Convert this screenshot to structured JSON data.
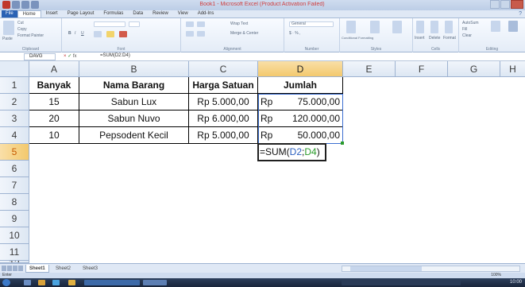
{
  "window": {
    "title": "Book1 - Microsoft Excel (Product Activation Failed)"
  },
  "ribbon": {
    "file_tab": "File",
    "tabs": [
      "Home",
      "Insert",
      "Page Layout",
      "Formulas",
      "Data",
      "Review",
      "View",
      "Add-Ins"
    ],
    "active_tab": "Home",
    "groups": [
      "Clipboard",
      "Font",
      "Alignment",
      "Number",
      "Styles",
      "Cells",
      "Editing"
    ],
    "buttons": {
      "paste": "Paste",
      "cut": "Cut",
      "copy": "Copy",
      "format_painter": "Format Painter",
      "wrap_text": "Wrap Text",
      "merge_center": "Merge & Center",
      "number_format": "General",
      "conditional_formatting": "Conditional Formatting",
      "format_as_table": "Format as Table",
      "cell_styles": "Cell Styles",
      "insert": "Insert",
      "delete": "Delete",
      "format": "Format",
      "autosum": "AutoSum",
      "fill": "Fill",
      "clear": "Clear",
      "sort_filter": "Sort & Filter",
      "find_select": "Find & Select"
    }
  },
  "formula_bar": {
    "name_box": "DAVG",
    "cancel": "×",
    "enter": "✓",
    "fx": "fx",
    "formula": "=SUM(D2:D4)"
  },
  "columns": [
    "A",
    "B",
    "C",
    "D",
    "E",
    "F",
    "G",
    "H"
  ],
  "rows": [
    "1",
    "2",
    "3",
    "4",
    "5",
    "6",
    "7",
    "8",
    "9",
    "10",
    "11",
    "12"
  ],
  "table": {
    "headers": [
      "Banyak",
      "Nama Barang",
      "Harga Satuan",
      "Jumlah"
    ],
    "rows": [
      {
        "banyak": "15",
        "nama": "Sabun Lux",
        "harga": "Rp 5.000,00",
        "jumlah_cur": "Rp",
        "jumlah_val": "75.000,00"
      },
      {
        "banyak": "20",
        "nama": "Sabun Nuvo",
        "harga": "Rp 6.000,00",
        "jumlah_cur": "Rp",
        "jumlah_val": "120.000,00"
      },
      {
        "banyak": "10",
        "nama": "Pepsodent Kecil",
        "harga": "Rp 5.000,00",
        "jumlah_cur": "Rp",
        "jumlah_val": "50.000,00"
      }
    ],
    "edit_cell": {
      "prefix": "=SUM(",
      "ref1": "D2",
      "sep": ";",
      "ref2": "D4",
      "suffix": ")"
    }
  },
  "sheets": [
    "Sheet1",
    "Sheet2",
    "Sheet3"
  ],
  "status": {
    "mode": "Enter",
    "zoom": "100%"
  },
  "taskbar": {
    "clock": "10:00"
  },
  "colors": {
    "accent": "#2a62b4",
    "selected_header": "#f3c96d",
    "ref_blue": "#2a5fbf",
    "ref_green": "#2a9a2a"
  }
}
